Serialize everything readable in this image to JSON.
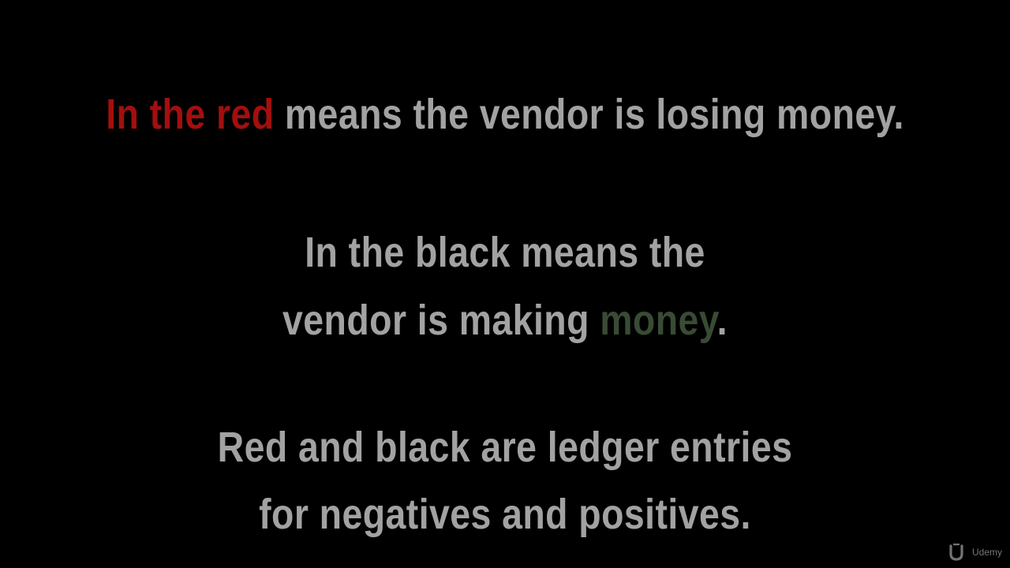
{
  "slide": {
    "line1": {
      "highlight": "In the red",
      "rest": " means the vendor is losing money."
    },
    "line2": {
      "text": "In the black means the"
    },
    "line3": {
      "before": "vendor is making ",
      "highlight": "money",
      "after": "."
    },
    "line4": {
      "text": "Red and black are ledger entries"
    },
    "line5": {
      "text": "for negatives and positives."
    }
  },
  "logo": {
    "icon": "udemy-u-icon",
    "text": "Udemy"
  },
  "colors": {
    "background": "#000000",
    "text": "#a2a2a2",
    "red_highlight": "#a30f0f",
    "green_highlight": "#394b34"
  }
}
